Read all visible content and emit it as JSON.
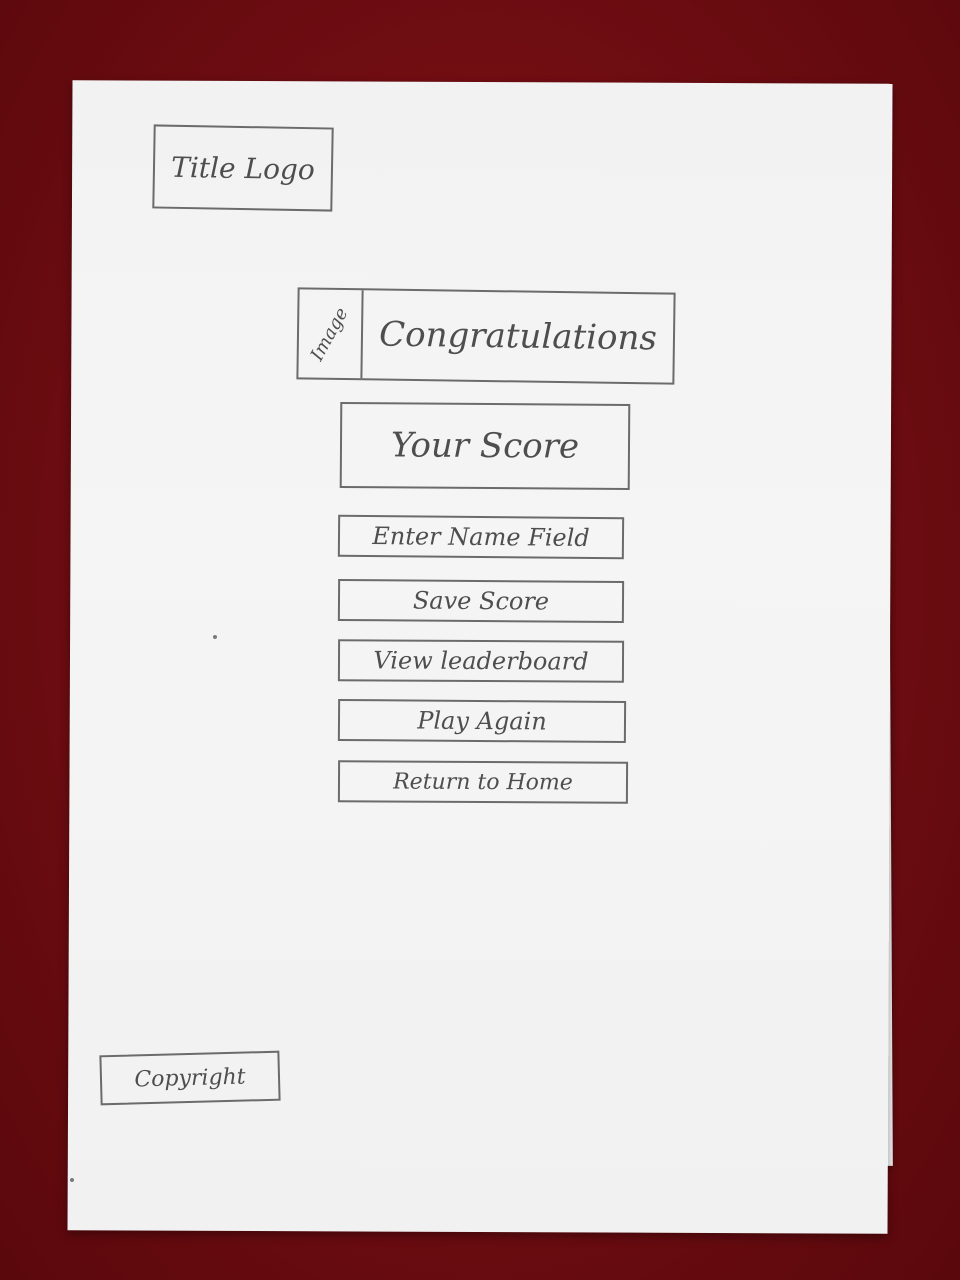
{
  "header": {
    "title_logo": "Title Logo"
  },
  "hero": {
    "image_label": "Image",
    "heading": "Congratulations"
  },
  "score": {
    "label": "Your Score"
  },
  "actions": {
    "enter_name": "Enter Name Field",
    "save_score": "Save Score",
    "view_leaderboard": "View leaderboard",
    "play_again": "Play Again",
    "return_home": "Return to Home"
  },
  "footer": {
    "copyright": "Copyright"
  }
}
